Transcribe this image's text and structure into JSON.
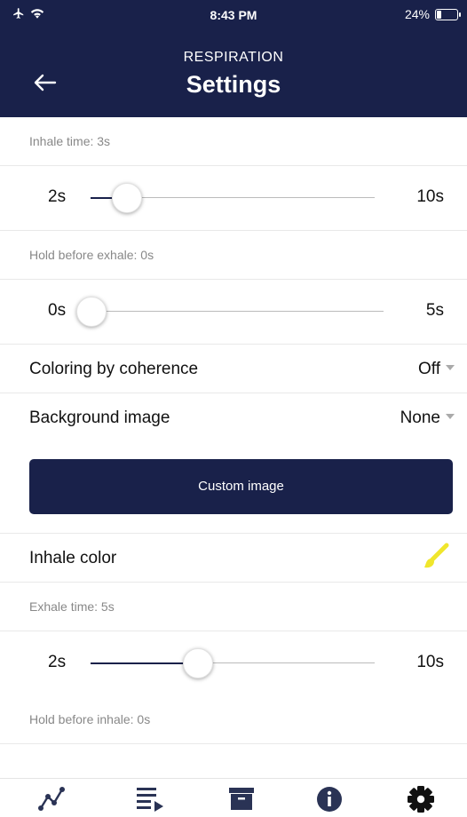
{
  "status_bar": {
    "time": "8:43 PM",
    "battery": "24%",
    "battery_level": 0.24
  },
  "header": {
    "subtitle": "RESPIRATION",
    "title": "Settings",
    "back_icon": "back-arrow-icon"
  },
  "inhale": {
    "time_label": "Inhale time: 3s",
    "slider": {
      "min_label": "2s",
      "max_label": "10s",
      "value": 3,
      "min": 2,
      "max": 10
    }
  },
  "hold_exhale": {
    "label": "Hold before exhale: 0s",
    "slider": {
      "min_label": "0s",
      "max_label": "5s",
      "value": 0,
      "min": 0,
      "max": 5
    }
  },
  "coloring": {
    "label": "Coloring by coherence",
    "value": "Off"
  },
  "background": {
    "label": "Background image",
    "value": "None"
  },
  "custom_image": {
    "label": "Custom image"
  },
  "inhale_color": {
    "label": "Inhale color",
    "color": "#f0e62c"
  },
  "exhale": {
    "time_label": "Exhale time: 5s",
    "slider": {
      "min_label": "2s",
      "max_label": "10s",
      "value": 5,
      "min": 2,
      "max": 10
    }
  },
  "hold_inhale": {
    "label": "Hold before inhale: 0s"
  },
  "theme": {
    "primary": "#19214a",
    "accent": "#f0e62c"
  },
  "tabbar": {
    "items": [
      "chart-icon",
      "playlist-icon",
      "archive-icon",
      "info-icon",
      "settings-icon"
    ]
  }
}
